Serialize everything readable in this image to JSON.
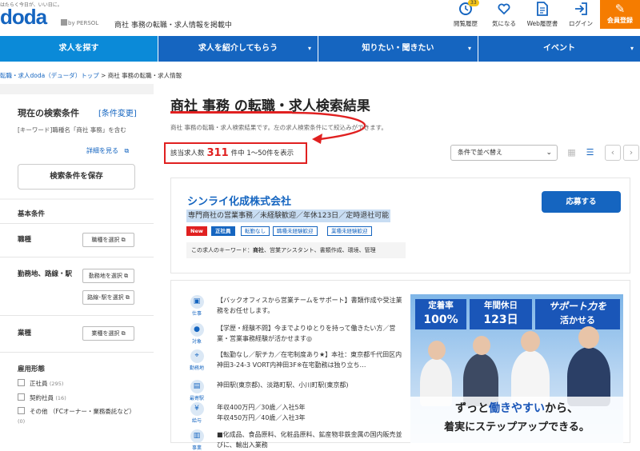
{
  "header": {
    "tagline": "はたらく今日が、いい日に。",
    "logo": "doda",
    "by_persol": "by PERSOL",
    "description": "商社 事務の転職・求人情報を掲載中",
    "icons": [
      {
        "name": "history",
        "label": "閲覧履歴",
        "badge": "33",
        "icon": "clock-icon"
      },
      {
        "name": "favorite",
        "label": "気になる",
        "icon": "heart-icon"
      },
      {
        "name": "resume",
        "label": "Web履歴書",
        "icon": "document-icon"
      },
      {
        "name": "login",
        "label": "ログイン",
        "icon": "login-icon"
      }
    ],
    "register_label": "会員登録"
  },
  "nav": {
    "tabs": [
      {
        "label": "求人を探す",
        "active": true
      },
      {
        "label": "求人を紹介してもらう",
        "active": false
      },
      {
        "label": "知りたい・聞きたい",
        "active": false
      },
      {
        "label": "イベント",
        "active": false
      }
    ]
  },
  "breadcrumb": {
    "link": "転職・求人doda（デューダ）トップ",
    "sep": ">",
    "current": "商社 事務の転職・求人情報"
  },
  "sidebar": {
    "title": "現在の検索条件",
    "change": "[条件変更]",
    "keyword": "[キーワード]職種名「商社 事務」を含む",
    "detail": "詳細を見る",
    "save": "検索条件を保存",
    "basic": "基本条件",
    "job_type": "職種",
    "job_type_btn": "職種を選択",
    "location": "勤務地、路線・駅",
    "location_btn": "勤務地を選択",
    "station_btn": "路線･駅を選択",
    "industry": "業種",
    "industry_btn": "業種を選択",
    "employment": "雇用形態",
    "checks": [
      {
        "label": "正社員",
        "count": "(295)"
      },
      {
        "label": "契約社員",
        "count": "(16)"
      },
      {
        "label": "その他 （FCオーナー・業務委託など）",
        "count": "(0)"
      }
    ]
  },
  "main": {
    "title": "商社 事務 の転職・求人検索結果",
    "subtitle": "商社 事務の転職・求人検索結果です。左の求人検索条件にて絞込みができます。",
    "count_prefix": "該当求人数",
    "count": "311",
    "count_suffix": "件中 1～50件を表示",
    "sort": "条件で並べ替え"
  },
  "job": {
    "company": "シンライ化成株式会社",
    "title": "専門商社の営業事務／未経験歓迎／年休123日／定時退社可能",
    "tags": [
      {
        "label": "New",
        "style": "new"
      },
      {
        "label": "正社員",
        "style": "fill"
      },
      {
        "label": "転勤なし",
        "style": "outline"
      },
      {
        "label": "職種未経験歓迎",
        "style": "outline"
      },
      {
        "label": "業種未経験歓迎",
        "style": "outline"
      }
    ],
    "keywords_prefix": "この求人のキーワード：",
    "keywords_bold": "商社",
    "keywords_rest": "、営業アシスタント、書類作成、環境、管理",
    "apply": "応募する",
    "details": [
      {
        "icon": "仕事",
        "text": "【バックオフィスから営業チームをサポート】書類作成や受注業務をお任せします。"
      },
      {
        "icon": "対象",
        "text": "【学歴・経験不問】今までよりゆとりを持って働きたい方／営業・営業事務経験が活かせます◎"
      },
      {
        "icon": "勤務地",
        "text": "【転勤なし／駅チカ／在宅制度あり★】本社：東京都千代田区内神田3-24-3 VORT内神田3F※在宅勤務は独り立ち…"
      },
      {
        "icon": "最寄駅",
        "text": "神田駅(東京都)、淡路町駅、小川町駅(東京都)"
      },
      {
        "icon": "給与",
        "text": "年収400万円／30歳／入社5年\n年収450万円／40歳／入社3年"
      },
      {
        "icon": "事業",
        "text": "■化成品、食品原料、化粧品原料、鉱産物非鉄金属の国内販売並びに、輸出入業務"
      }
    ],
    "banner": {
      "box1_top": "定着率",
      "box1_bottom": "100%",
      "box2_top": "年間休日",
      "box2_bottom": "123日",
      "box3_top": "サポート力を",
      "box3_bottom": "活かせる",
      "copy1_a": "ずっと",
      "copy1_em": "働きやすい",
      "copy1_b": "から、",
      "copy2": "着実にステップアップできる。"
    }
  },
  "colors": {
    "brand": "#1565c0",
    "accent": "#f57c00",
    "alert": "#e02020"
  }
}
